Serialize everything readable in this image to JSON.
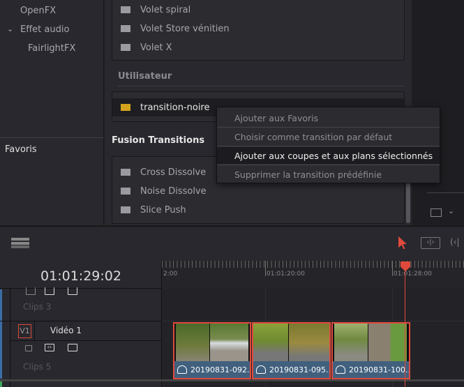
{
  "sidebar": {
    "items": [
      {
        "label": "OpenFX"
      },
      {
        "label": "Effet audio",
        "expanded": true
      },
      {
        "label": "FairlightFX"
      }
    ],
    "favorites": "Favoris"
  },
  "transitions": {
    "group1": [
      "Volet spiral",
      "Volet Store vénitien",
      "Volet X"
    ],
    "user_header": "Utilisateur",
    "user_items": [
      "transition-noire"
    ],
    "fusion_header": "Fusion Transitions",
    "fusion_items": [
      "Cross Dissolve",
      "Noise Dissolve",
      "Slice Push"
    ]
  },
  "context_menu": {
    "items": [
      "Ajouter aux Favoris",
      "Choisir comme transition par défaut",
      "Ajouter aux coupes et aux plans sélectionnés",
      "Supprimer la transition prédéfinie"
    ],
    "highlighted_index": 2
  },
  "timeline": {
    "timecode": "01:01:29:02",
    "ruler_labels": [
      "2:00",
      "01:01:20:00",
      "01:01:28:00"
    ],
    "tracks": [
      {
        "clips_label": "Clips 3"
      },
      {
        "id": "V1",
        "name": "Vidéo 1",
        "clips_label": "Clips 5"
      }
    ],
    "clips": [
      "20190831-092...",
      "20190831-095...",
      "20190831-100..."
    ]
  },
  "colors": {
    "accent": "#e04a3c",
    "clip": "#41607e",
    "user_icon": "#d4a21c"
  }
}
